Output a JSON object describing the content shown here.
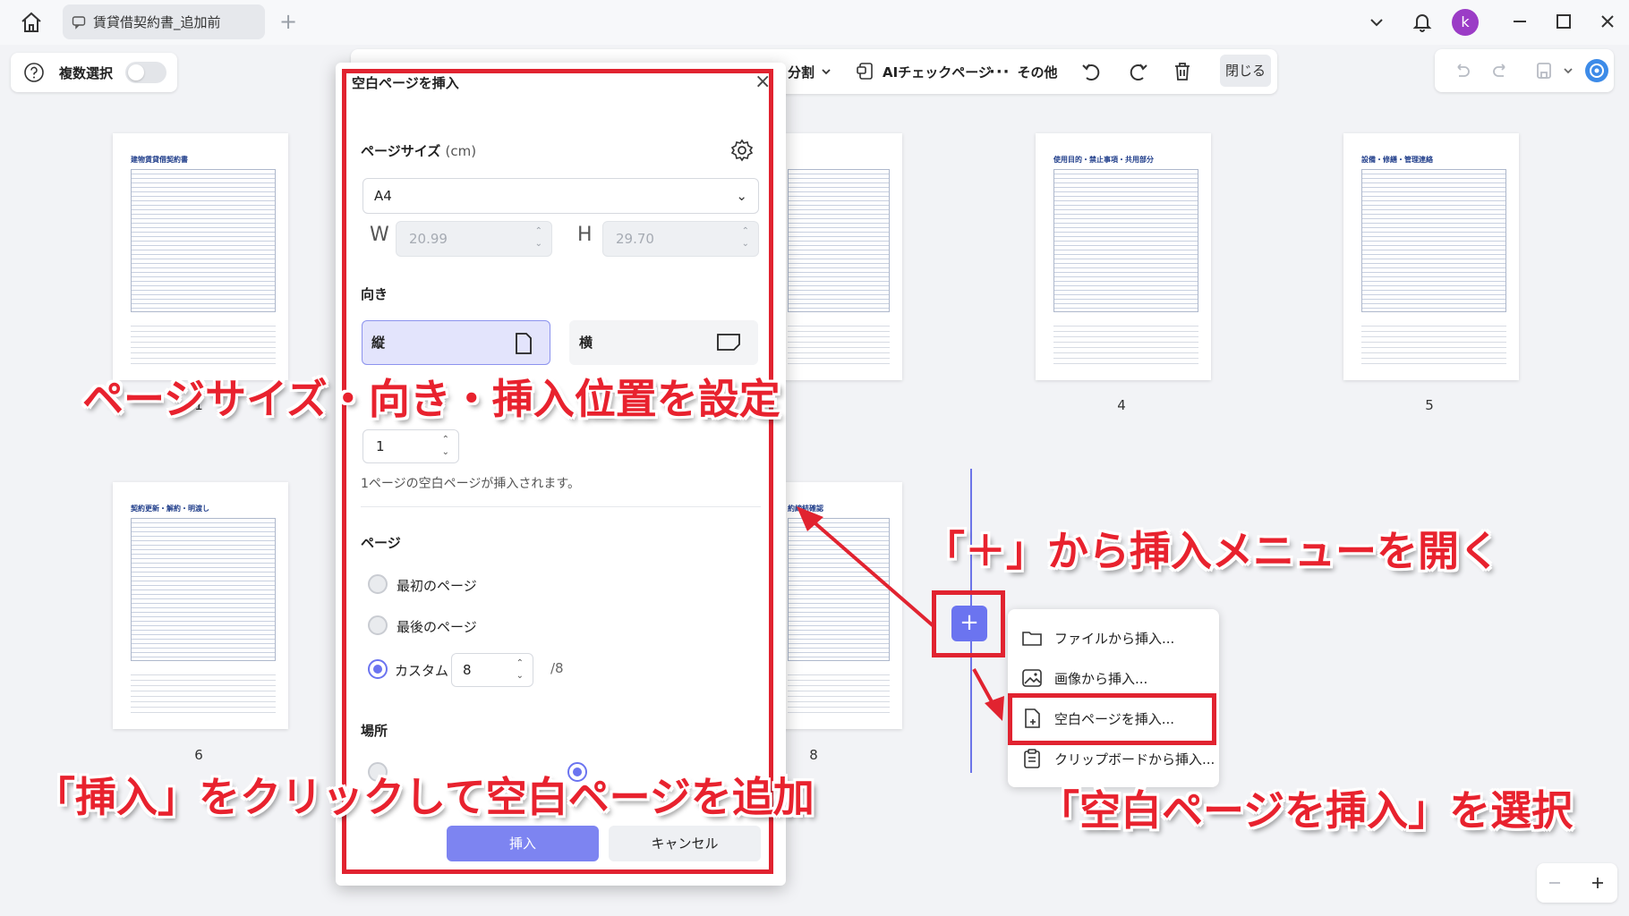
{
  "titlebar": {
    "doc_tab_label": "賃貸借契約書_追加前",
    "avatar_letter": "k"
  },
  "toolbar": {
    "multi_select_label": "複数選択",
    "split_label": "分割",
    "ai_check_label": "AIチェックページ",
    "more_label": "その他",
    "close_label": "閉じる"
  },
  "thumbnails": [
    {
      "title": "建物賃貸借契約書",
      "number": "1"
    },
    {
      "title": "",
      "number": ""
    },
    {
      "title": "使用目的・禁止事項・共用部分",
      "number": "4"
    },
    {
      "title": "設備・修繕・管理連絡",
      "number": "5"
    },
    {
      "title": "契約更新・解約・明渡し",
      "number": "6"
    },
    {
      "title": "約締結確認",
      "number": "8"
    }
  ],
  "insert_menu": {
    "items": [
      {
        "label": "ファイルから挿入..."
      },
      {
        "label": "画像から挿入..."
      },
      {
        "label": "空白ページを挿入..."
      },
      {
        "label": "クリップボードから挿入..."
      }
    ]
  },
  "dialog": {
    "title": "空白ページを挿入",
    "page_size_label": "ページサイズ",
    "page_size_unit": "(cm)",
    "size_value": "A4",
    "width_letter": "W",
    "width_value": "20.99",
    "height_letter": "H",
    "height_value": "29.70",
    "orientation_label": "向き",
    "portrait_label": "縦",
    "landscape_label": "横",
    "count_value": "1",
    "hint": "1ページの空白ページが挿入されます。",
    "page_label": "ページ",
    "first_page_label": "最初のページ",
    "last_page_label": "最後のページ",
    "custom_label": "カスタム",
    "custom_value": "8",
    "total_pages": "/8",
    "location_label": "場所",
    "insert_label": "挿入",
    "cancel_label": "キャンセル"
  },
  "annotations": {
    "settings": "ページサイズ・向き・挿入位置を設定",
    "open_menu": "「＋」から挿入メニューを開く",
    "click_insert": "「挿入」をクリックして空白ページを追加",
    "select_blank": "「空白ページを挿入」を選択"
  },
  "colors": {
    "accent": "#6b74f0",
    "annotation_red": "#e12330"
  }
}
